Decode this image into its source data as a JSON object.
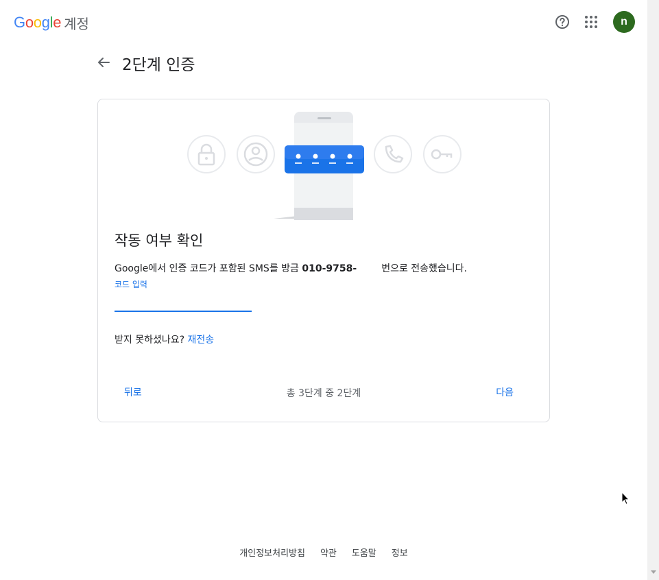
{
  "header": {
    "logo_letters": [
      {
        "ch": "G",
        "color": "#4285F4"
      },
      {
        "ch": "o",
        "color": "#EA4335"
      },
      {
        "ch": "o",
        "color": "#FBBC05"
      },
      {
        "ch": "g",
        "color": "#4285F4"
      },
      {
        "ch": "l",
        "color": "#34A853"
      },
      {
        "ch": "e",
        "color": "#EA4335"
      }
    ],
    "product": "계정",
    "help_icon": "help-circle-icon",
    "apps_icon": "apps-grid-icon",
    "avatar_letter": "n",
    "avatar_color": "#2d6a1f"
  },
  "title_row": {
    "back_icon": "arrow-left-icon",
    "title": "2단계 인증"
  },
  "card": {
    "heading": "작동 여부 확인",
    "sms_text_before": "Google에서 인증 코드가 포함된 SMS를 방금 ",
    "phone_number": "010-9758-",
    "sms_text_after": "번으로 전송했습니다.",
    "code_label": "코드 입력",
    "code_value": "",
    "resend_question": "받지 못하셨나요? ",
    "resend_link": "재전송",
    "back_button": "뒤로",
    "step_text": "총 3단계 중 2단계",
    "next_button": "다음"
  },
  "illustration_icons": [
    "lock-icon",
    "account-icon",
    "phone-call-icon",
    "key-icon"
  ],
  "footer": {
    "links": [
      "개인정보처리방침",
      "약관",
      "도움말",
      "정보"
    ]
  },
  "colors": {
    "accent": "#1a73e8",
    "border": "#dadce0"
  }
}
